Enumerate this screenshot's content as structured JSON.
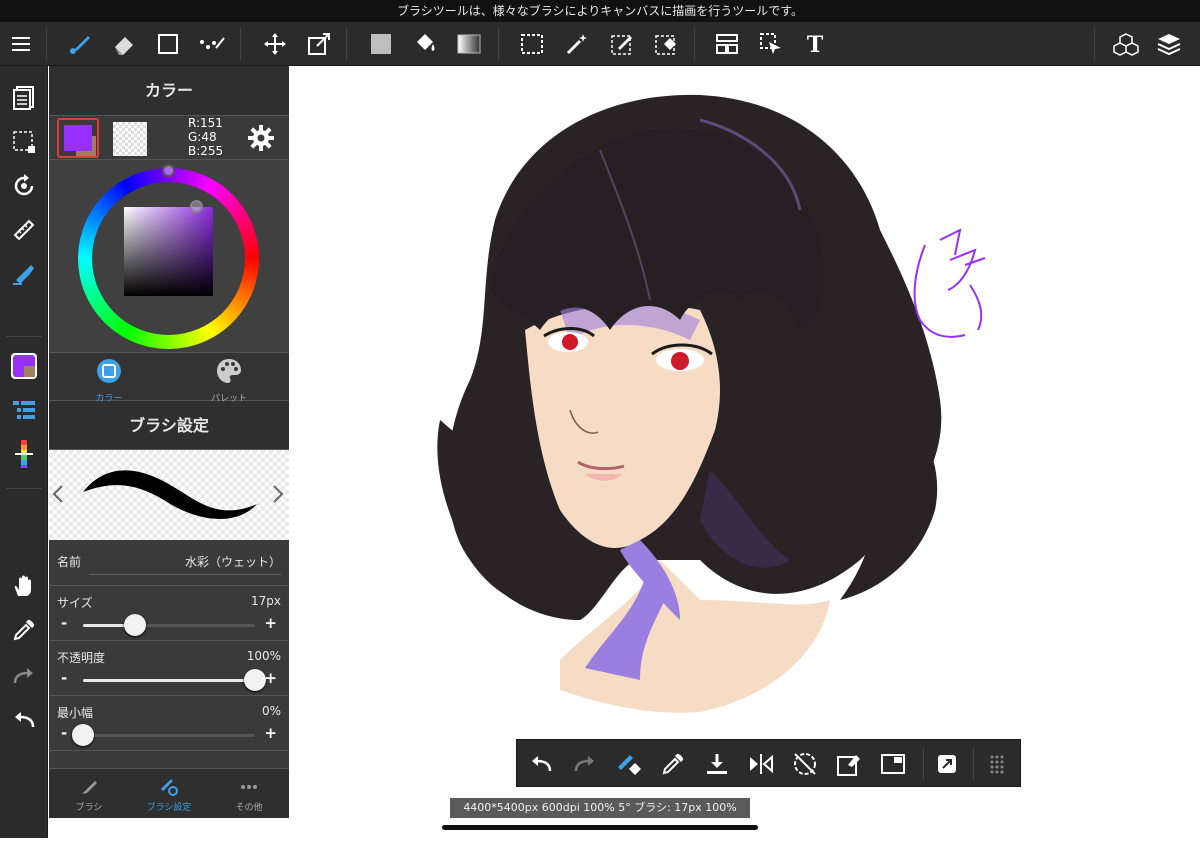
{
  "status_message": "ブラシツールは、様々なブラシによりキャンバスに描画を行うツールです。",
  "toolbar": {
    "icons": [
      "menu-icon",
      "brush-icon",
      "eraser-icon",
      "rectangle-icon",
      "dot-icon",
      "move-icon",
      "transform-icon",
      "fill-color-icon",
      "bucket-icon",
      "gradient-icon",
      "select-rect-icon",
      "magic-wand-icon",
      "select-pen-icon",
      "select-eraser-icon",
      "frame-divider-icon",
      "operation-icon",
      "text-icon",
      "3d-icon",
      "layers-icon"
    ]
  },
  "leftbar": {
    "icons": [
      "pages-icon",
      "selection-icon",
      "rotate-icon",
      "ruler-icon",
      "snap-icon",
      "current-color-icon",
      "list-icon",
      "color-bar-icon",
      "hand-icon",
      "eyedropper-icon",
      "redo-icon",
      "undo-icon"
    ]
  },
  "color_panel": {
    "title": "カラー",
    "rgb": {
      "r": "R:151",
      "g": "G:48",
      "b": "B:255"
    },
    "primary_color": "#9730ff",
    "tabs": [
      {
        "label": "カラー"
      },
      {
        "label": "パレット"
      }
    ]
  },
  "brush_panel": {
    "title": "ブラシ設定",
    "name_label": "名前",
    "name_value": "水彩（ウェット）",
    "size_label": "サイズ",
    "size_value": "17px",
    "size_fraction": 0.3,
    "opacity_label": "不透明度",
    "opacity_value": "100%",
    "opacity_fraction": 1.0,
    "minwidth_label": "最小幅",
    "minwidth_value": "0%",
    "minwidth_fraction": 0.0,
    "minus": "-",
    "plus": "+"
  },
  "bottom_tabs": [
    {
      "label": "ブラシ"
    },
    {
      "label": "ブラシ設定"
    },
    {
      "label": "その他"
    }
  ],
  "canvas": {
    "signature_text": "タガメリカ"
  },
  "status_bar": {
    "text": "4400*5400px 600dpi 100% 5° ブラシ: 17px 100%"
  },
  "colors": {
    "accent": "#3ea0e6",
    "panel_bg": "#3a3a3a",
    "toolbar_bg": "#2b2b2b"
  }
}
